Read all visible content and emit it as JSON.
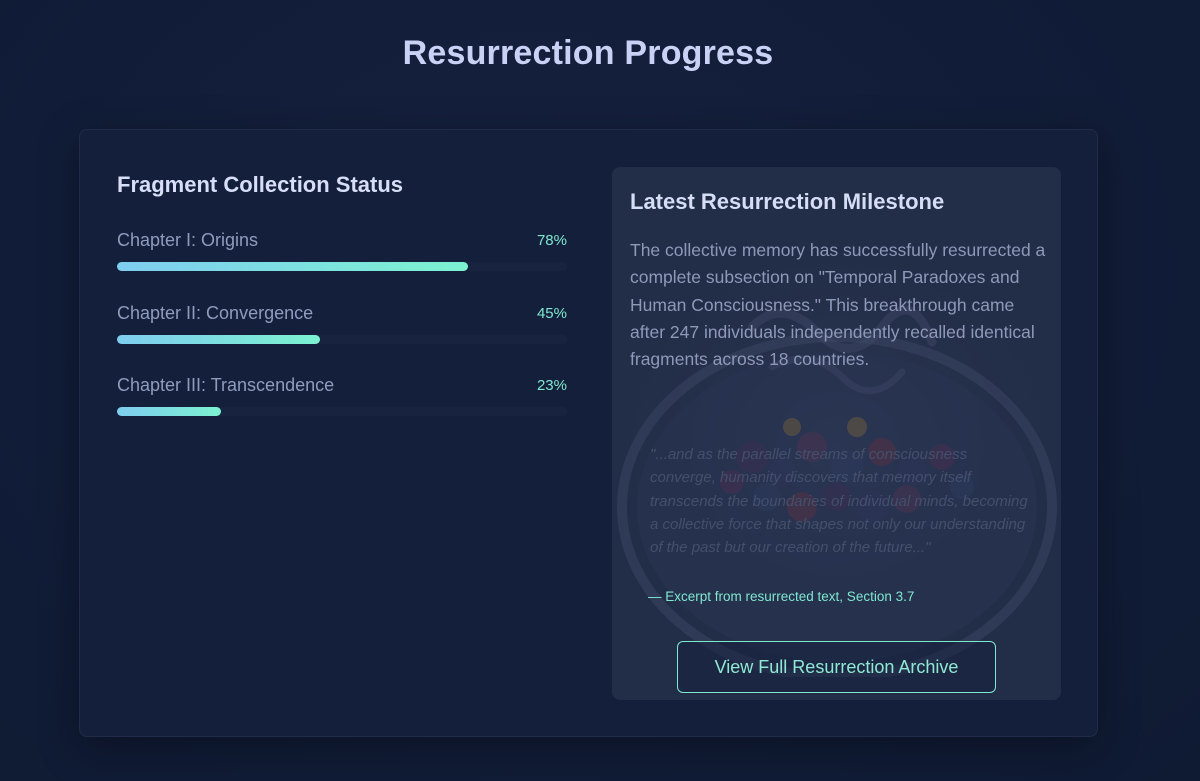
{
  "page": {
    "title": "Resurrection Progress"
  },
  "fragment_status": {
    "title": "Fragment Collection Status",
    "items": [
      {
        "label": "Chapter I: Origins",
        "percent_text": "78%",
        "value": 78
      },
      {
        "label": "Chapter II: Convergence",
        "percent_text": "45%",
        "value": 45
      },
      {
        "label": "Chapter III: Transcendence",
        "percent_text": "23%",
        "value": 23
      }
    ]
  },
  "milestone": {
    "title": "Latest Resurrection Milestone",
    "text": "The collective memory has successfully resurrected a complete subsection on \"Temporal Paradoxes and Human Consciousness.\" This breakthrough came after 247 individuals independently recalled identical fragments across 18 countries.",
    "excerpt": "\"...and as the parallel streams of consciousness converge, humanity discovers that memory itself transcends the boundaries of individual minds, becoming a collective force that shapes not only our understanding of the past but our creation of the future...\"",
    "excerpt_source": "— Excerpt from resurrected text, Section 3.7",
    "button_label": "View Full Resurrection Archive"
  },
  "colors": {
    "accent": "#7fe8cf",
    "bar_start": "#7ecdf0",
    "bar_end": "#7cf2d0",
    "background": "#111d38",
    "card": "#14203b"
  }
}
